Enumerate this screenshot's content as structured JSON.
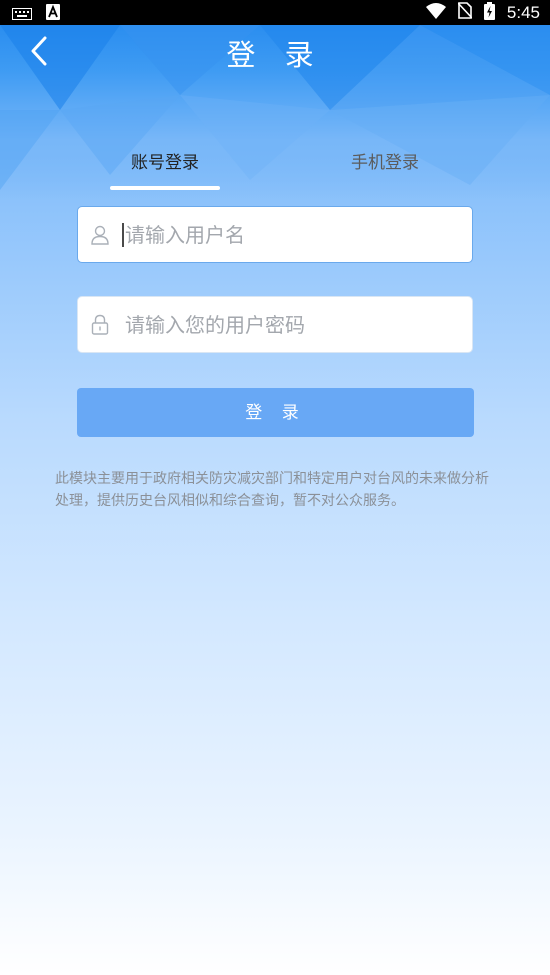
{
  "status_bar": {
    "time": "5:45",
    "icons": [
      "keyboard-icon",
      "text-a-icon",
      "wifi-icon",
      "no-sim-icon",
      "battery-charging-icon"
    ]
  },
  "header": {
    "title": "登 录",
    "back_icon": "chevron-left-icon"
  },
  "tabs": [
    {
      "label": "账号登录",
      "active": true
    },
    {
      "label": "手机登录",
      "active": false
    }
  ],
  "form": {
    "username": {
      "placeholder": "请输入用户名",
      "value": "",
      "icon": "user-icon"
    },
    "password": {
      "placeholder": "请输入您的用户密码",
      "value": "",
      "icon": "lock-icon"
    },
    "submit_label": "登 录"
  },
  "notice": "此模块主要用于政府相关防灾减灾部门和特定用户对台风的未来做分析处理，提供历史台风相似和综合查询，暂不对公众服务。",
  "colors": {
    "accent": "#68a8f5",
    "header_top": "#1f86ee",
    "notice_text": "#8b9097"
  }
}
